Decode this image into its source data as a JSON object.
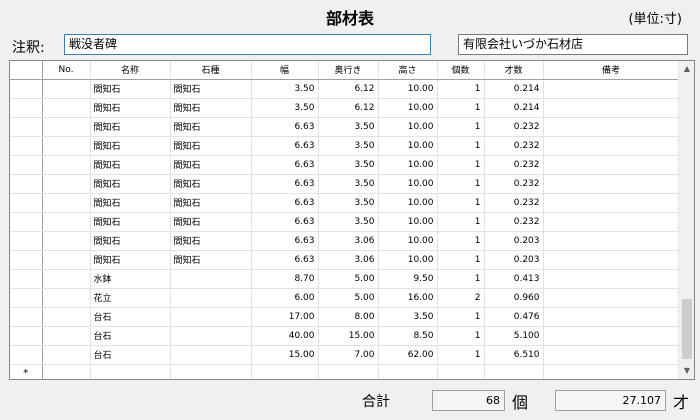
{
  "header": {
    "title": "部材表",
    "unit": "(単位:寸)"
  },
  "note": {
    "label": "注釈:",
    "value": "戦没者碑"
  },
  "company": {
    "value": "有限会社いづか石材店"
  },
  "columns": [
    "No.",
    "名称",
    "石種",
    "幅",
    "奥行き",
    "高さ",
    "個数",
    "才数",
    "備考"
  ],
  "rows": [
    {
      "name": "間知石",
      "stone": "間知石",
      "width": "3.50",
      "depth": "6.12",
      "height": "10.00",
      "count": "1",
      "sai": "0.214"
    },
    {
      "name": "間知石",
      "stone": "間知石",
      "width": "3.50",
      "depth": "6.12",
      "height": "10.00",
      "count": "1",
      "sai": "0.214"
    },
    {
      "name": "間知石",
      "stone": "間知石",
      "width": "6.63",
      "depth": "3.50",
      "height": "10.00",
      "count": "1",
      "sai": "0.232"
    },
    {
      "name": "間知石",
      "stone": "間知石",
      "width": "6.63",
      "depth": "3.50",
      "height": "10.00",
      "count": "1",
      "sai": "0.232"
    },
    {
      "name": "間知石",
      "stone": "間知石",
      "width": "6.63",
      "depth": "3.50",
      "height": "10.00",
      "count": "1",
      "sai": "0.232"
    },
    {
      "name": "間知石",
      "stone": "間知石",
      "width": "6.63",
      "depth": "3.50",
      "height": "10.00",
      "count": "1",
      "sai": "0.232"
    },
    {
      "name": "間知石",
      "stone": "間知石",
      "width": "6.63",
      "depth": "3.50",
      "height": "10.00",
      "count": "1",
      "sai": "0.232"
    },
    {
      "name": "間知石",
      "stone": "間知石",
      "width": "6.63",
      "depth": "3.50",
      "height": "10.00",
      "count": "1",
      "sai": "0.232"
    },
    {
      "name": "間知石",
      "stone": "間知石",
      "width": "6.63",
      "depth": "3.06",
      "height": "10.00",
      "count": "1",
      "sai": "0.203"
    },
    {
      "name": "間知石",
      "stone": "間知石",
      "width": "6.63",
      "depth": "3.06",
      "height": "10.00",
      "count": "1",
      "sai": "0.203"
    },
    {
      "name": "水鉢",
      "stone": "",
      "width": "8.70",
      "depth": "5.00",
      "height": "9.50",
      "count": "1",
      "sai": "0.413"
    },
    {
      "name": "花立",
      "stone": "",
      "width": "6.00",
      "depth": "5.00",
      "height": "16.00",
      "count": "2",
      "sai": "0.960"
    },
    {
      "name": "台石",
      "stone": "",
      "width": "17.00",
      "depth": "8.00",
      "height": "3.50",
      "count": "1",
      "sai": "0.476"
    },
    {
      "name": "台石",
      "stone": "",
      "width": "40.00",
      "depth": "15.00",
      "height": "8.50",
      "count": "1",
      "sai": "5.100"
    },
    {
      "name": "台石",
      "stone": "",
      "width": "15.00",
      "depth": "7.00",
      "height": "62.00",
      "count": "1",
      "sai": "6.510"
    }
  ],
  "new_row_marker": "*",
  "scroll": {
    "up": "▲",
    "down": "▼"
  },
  "footer": {
    "sum_label": "合計",
    "count_total": "68",
    "count_unit": "個",
    "sai_total": "27.107",
    "sai_unit": "才"
  }
}
